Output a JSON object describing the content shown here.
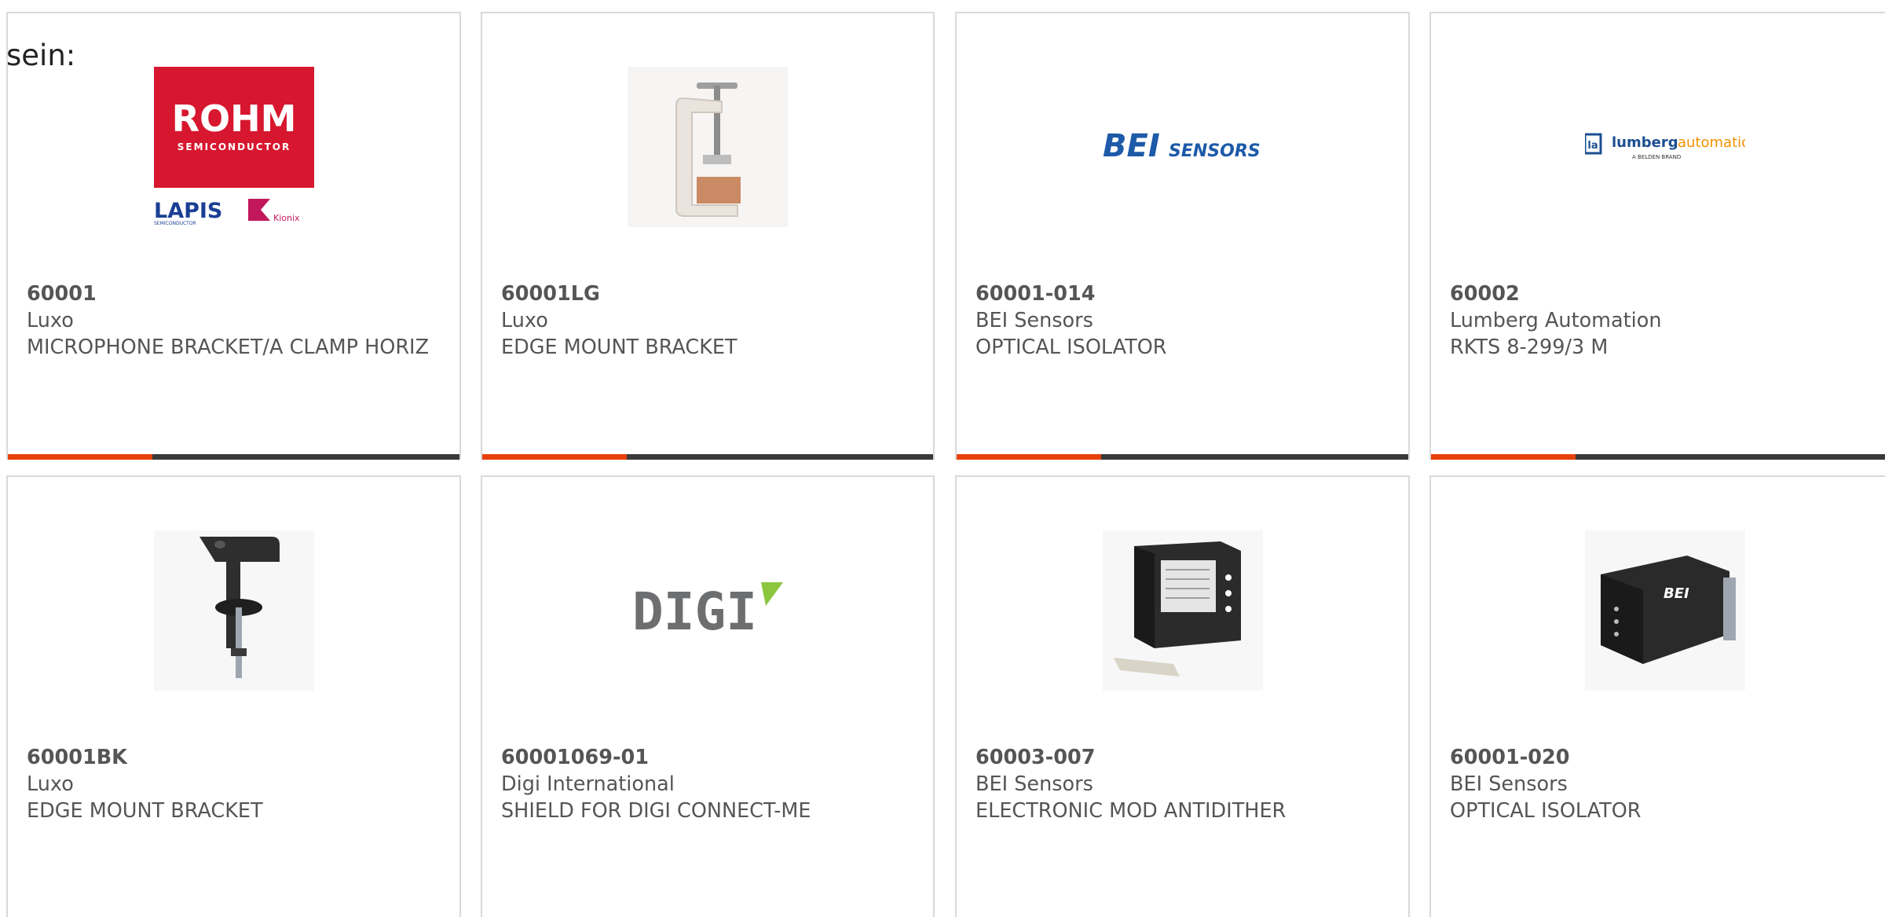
{
  "lead_text": "sein:",
  "colors": {
    "accent": "#e8410b",
    "bar_dark": "#3a3a3a",
    "card_border": "#d9d9d9",
    "text": "#555555",
    "rohm_red": "#d7172f",
    "bei_blue": "#1d5aa8"
  },
  "products": [
    {
      "part_number": "60001",
      "manufacturer": "Luxo",
      "description": "MICROPHONE BRACKET/A CLAMP HORIZ",
      "image_icon": "rohm-lapis-kionix-logo",
      "logo": {
        "line1": "ROHM",
        "line2": "SEMICONDUCTOR",
        "line3": "LAPIS",
        "line4": "SEMICONDUCTOR",
        "line5": "Kionix"
      }
    },
    {
      "part_number": "60001LG",
      "manufacturer": "Luxo",
      "description": "EDGE MOUNT BRACKET",
      "image_icon": "white-clamp-photo"
    },
    {
      "part_number": "60001-014",
      "manufacturer": "BEI Sensors",
      "description": "OPTICAL ISOLATOR",
      "image_icon": "bei-sensors-logo",
      "logo": {
        "brand": "BEI",
        "suffix": "SENSORS"
      }
    },
    {
      "part_number": "60002",
      "manufacturer": "Lumberg Automation",
      "description": "RKTS 8-299/3 M",
      "image_icon": "lumberg-automation-logo",
      "logo": {
        "brand": "lumberg",
        "brand2": "automation",
        "tagline": "A BELDEN BRAND",
        "mark": "la"
      }
    },
    {
      "part_number": "60001BK",
      "manufacturer": "Luxo",
      "description": "EDGE MOUNT BRACKET",
      "image_icon": "black-clamp-photo"
    },
    {
      "part_number": "60001069-01",
      "manufacturer": "Digi International",
      "description": "SHIELD FOR DIGI CONNECT-ME",
      "image_icon": "digi-logo",
      "logo": {
        "brand": "DIGI"
      }
    },
    {
      "part_number": "60003-007",
      "manufacturer": "BEI Sensors",
      "description": "ELECTRONIC MOD ANTIDITHER",
      "image_icon": "din-rail-module-photo"
    },
    {
      "part_number": "60001-020",
      "manufacturer": "BEI Sensors",
      "description": "OPTICAL ISOLATOR",
      "image_icon": "optical-isolator-module-photo",
      "logo": {
        "brand": "BEI"
      }
    }
  ]
}
